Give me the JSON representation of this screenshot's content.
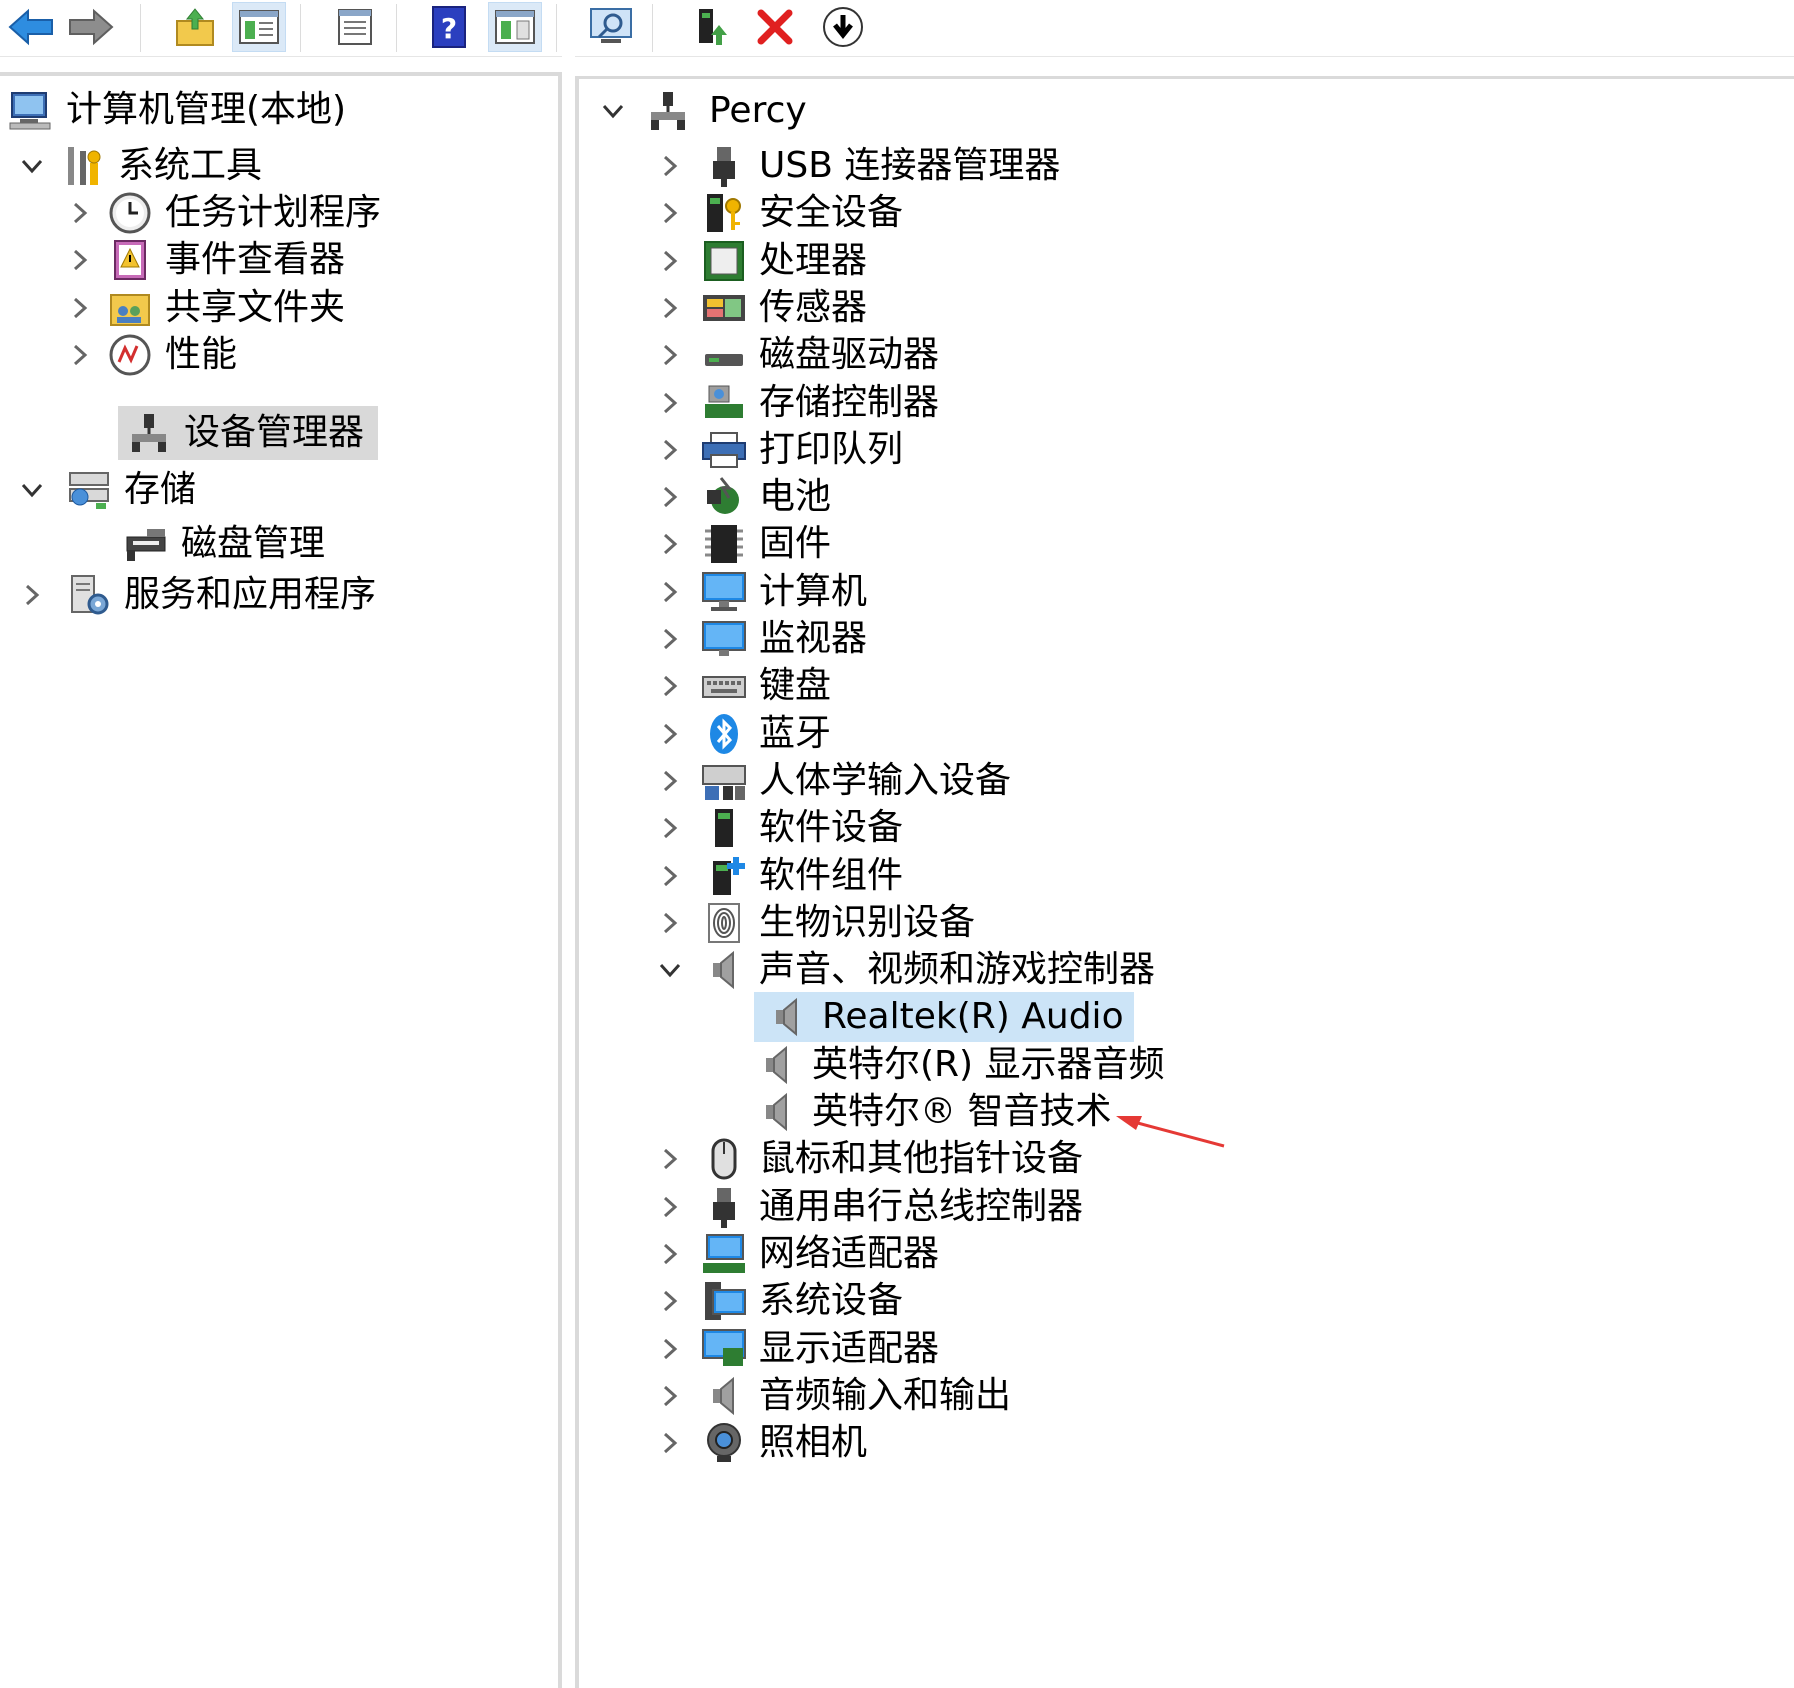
{
  "toolbar": {
    "buttons": [
      {
        "name": "back-button",
        "icon": "back-arrow-icon"
      },
      {
        "name": "forward-button",
        "icon": "forward-arrow-icon"
      },
      {
        "name": "up-one-level-button",
        "icon": "folder-up-icon"
      },
      {
        "name": "show-hide-console-tree-button",
        "icon": "console-tree-icon"
      },
      {
        "name": "properties-button",
        "icon": "properties-icon"
      },
      {
        "name": "help-button",
        "icon": "help-icon"
      },
      {
        "name": "show-hide-action-pane-button",
        "icon": "action-pane-icon"
      },
      {
        "name": "scan-hardware-button",
        "icon": "scan-monitor-icon"
      },
      {
        "name": "update-driver-button",
        "icon": "update-driver-icon"
      },
      {
        "name": "uninstall-device-button",
        "icon": "red-x-icon"
      },
      {
        "name": "disable-device-button",
        "icon": "down-arrow-circle-icon"
      }
    ]
  },
  "left_tree": {
    "root": "计算机管理(本地)",
    "system_tools": "系统工具",
    "task_scheduler": "任务计划程序",
    "event_viewer": "事件查看器",
    "shared_folders": "共享文件夹",
    "performance": "性能",
    "device_manager": "设备管理器",
    "storage": "存储",
    "disk_management": "磁盘管理",
    "services_apps": "服务和应用程序"
  },
  "device_tree": {
    "root": "Percy",
    "categories": [
      "USB 连接器管理器",
      "安全设备",
      "处理器",
      "传感器",
      "磁盘驱动器",
      "存储控制器",
      "打印队列",
      "电池",
      "固件",
      "计算机",
      "监视器",
      "键盘",
      "蓝牙",
      "人体学输入设备",
      "软件设备",
      "软件组件",
      "生物识别设备",
      "声音、视频和游戏控制器"
    ],
    "sound_children": [
      "Realtek(R) Audio",
      "英特尔(R) 显示器音频",
      "英特尔® 智音技术"
    ],
    "categories_after": [
      "鼠标和其他指针设备",
      "通用串行总线控制器",
      "网络适配器",
      "系统设备",
      "显示适配器",
      "音频输入和输出",
      "照相机"
    ]
  },
  "colors": {
    "selection_gray": "#d9d9d9",
    "highlight_blue": "#cce4f7",
    "annotation_red": "#e53935"
  }
}
